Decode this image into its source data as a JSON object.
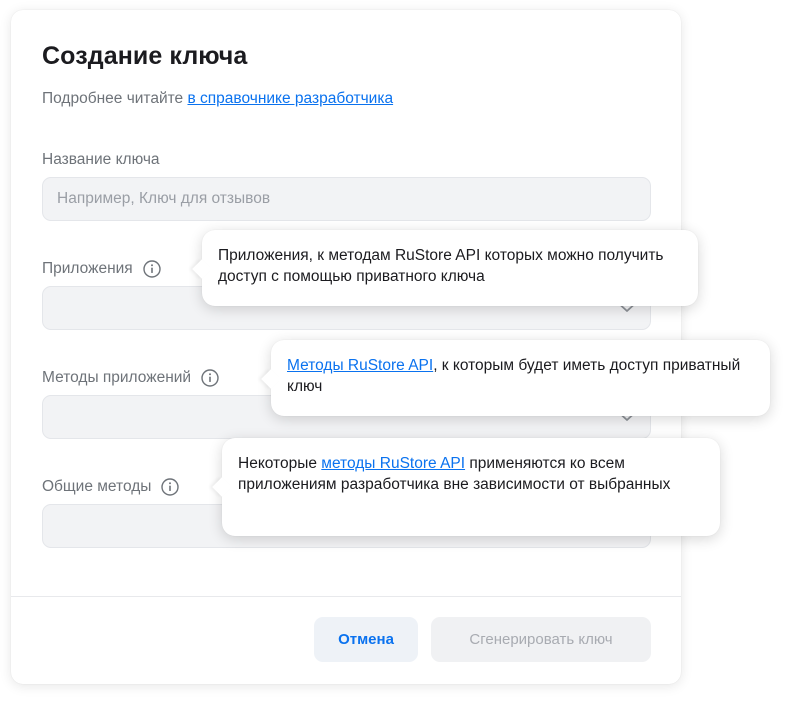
{
  "modal": {
    "title": "Создание ключа",
    "subtitle_text": "Подробнее читайте ",
    "subtitle_link": "в справочнике разработчика"
  },
  "form": {
    "key_name": {
      "label": "Название ключа",
      "placeholder": "Например, Ключ для отзывов",
      "value": ""
    },
    "applications": {
      "label": "Приложения",
      "value": ""
    },
    "app_methods": {
      "label": "Методы приложений",
      "value": ""
    },
    "common_methods": {
      "label": "Общие методы",
      "value": ""
    }
  },
  "tooltips": {
    "applications": {
      "text": "Приложения, к методам RuStore API которых можно получить доступ с помощью приватного ключа"
    },
    "app_methods": {
      "link": "Методы RuStore API",
      "text": ", к которым будет иметь доступ приватный ключ"
    },
    "common_methods": {
      "text_before": "Некоторые ",
      "link": "методы RuStore API",
      "text_after": " применяются ко всем приложениям разработчика вне зависимости от выбранных"
    }
  },
  "footer": {
    "cancel_label": "Отмена",
    "generate_label": "Сгенерировать ключ"
  },
  "colors": {
    "accent": "#0a72ef",
    "muted_text": "#6e7379",
    "field_bg": "#f2f3f5",
    "disabled_text": "#a8abb1"
  },
  "icons": {
    "info": "info-icon",
    "dropdown": "chevron-down-icon"
  }
}
